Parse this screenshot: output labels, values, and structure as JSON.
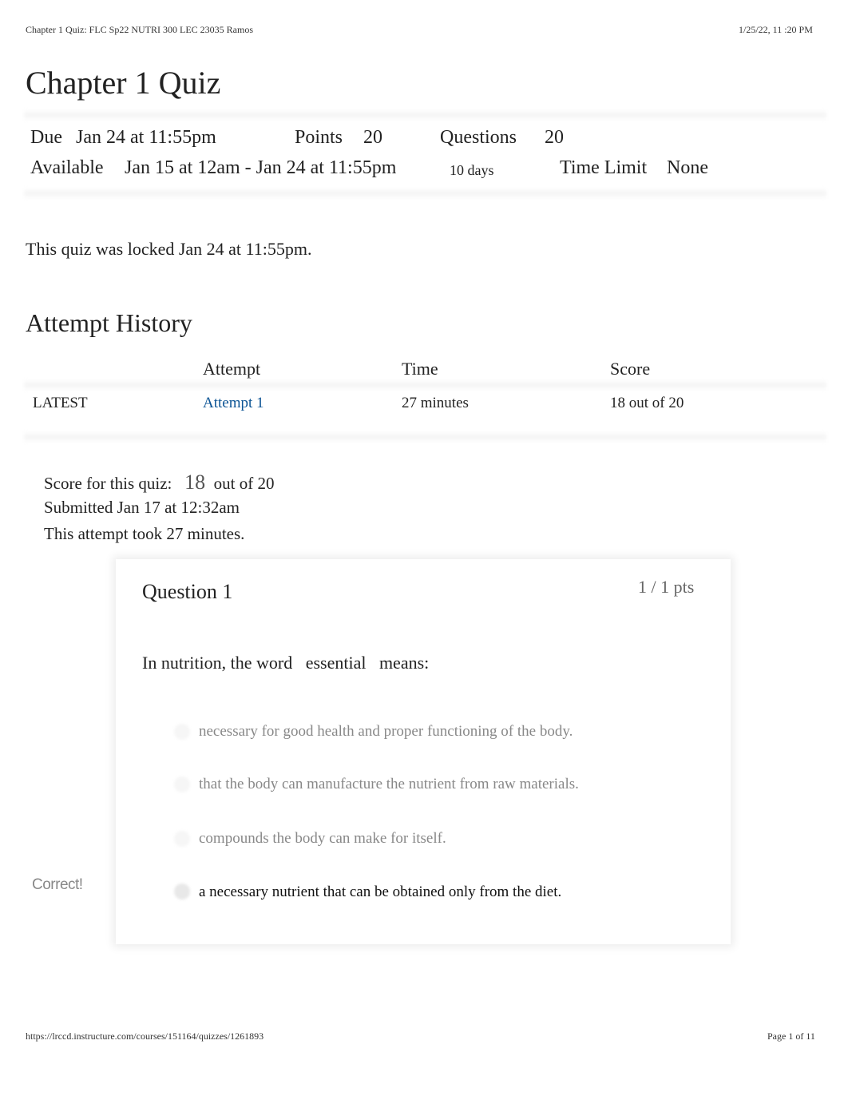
{
  "header": {
    "doc_title": "Chapter 1 Quiz: FLC Sp22 NUTRI 300 LEC 23035 Ramos",
    "datetime": "1/25/22, 11  :20 PM"
  },
  "title": "Chapter 1 Quiz",
  "details": {
    "due_label": "Due",
    "due": "Jan 24 at 11:55pm",
    "points_label": "Points",
    "points": "20",
    "questions_label": "Questions",
    "questions": "20",
    "available_label": "Available",
    "available": "Jan 15 at 12am - Jan 24 at 11:55pm",
    "available_days": "10 days",
    "time_limit_label": "Time Limit",
    "time_limit": "None"
  },
  "locked_msg": "This quiz was locked Jan 24 at 11:55pm.",
  "history": {
    "title": "Attempt History",
    "headers": [
      "Attempt",
      "Time",
      "Score"
    ],
    "row": {
      "tag": "LATEST",
      "attempt": "Attempt 1",
      "time": "27 minutes",
      "score": "18 out of 20"
    }
  },
  "summary": {
    "score_label": "Score for this quiz:",
    "score": "18",
    "score_out_of": "out of 20",
    "submitted": "Submitted Jan 17 at 12:32am",
    "duration": "This attempt took 27 minutes."
  },
  "question": {
    "title": "Question 1",
    "pts": "1 / 1 pts",
    "text": "In nutrition, the word   essential   means:",
    "answers": [
      "necessary for good health and proper functioning of the body.",
      "that the body can manufacture the nutrient from raw materials.",
      "compounds the body can make for itself.",
      "a necessary nutrient that can be obtained only from the diet."
    ],
    "correct_label": "Correct!"
  },
  "footer": {
    "url": "https://lrccd.instructure.com/courses/151164/quizzes/1261893",
    "page": "Page 1 of 11"
  },
  "colors": {
    "link": "#0b5394"
  }
}
